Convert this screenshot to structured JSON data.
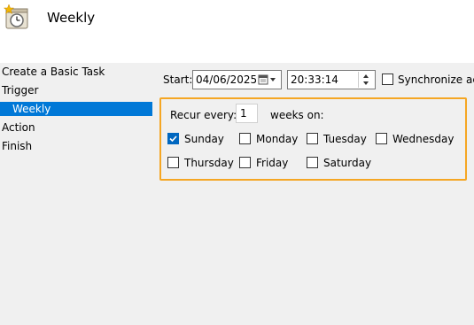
{
  "header": {
    "title": "Weekly",
    "icon": "scheduled-task-clock-icon"
  },
  "nav": {
    "items": [
      {
        "label": "Create a Basic Task"
      },
      {
        "label": "Trigger"
      },
      {
        "label": "Weekly"
      },
      {
        "label": "Action"
      },
      {
        "label": "Finish"
      }
    ],
    "selected": "Weekly"
  },
  "start": {
    "label": "Start:",
    "date": "04/06/2025",
    "time": "20:33:14",
    "sync_label": "Synchronize acro",
    "sync_checked": false
  },
  "recur": {
    "prefix": "Recur every:",
    "value": "1",
    "suffix": "weeks on:"
  },
  "days": [
    {
      "label": "Sunday",
      "checked": true
    },
    {
      "label": "Monday",
      "checked": false
    },
    {
      "label": "Tuesday",
      "checked": false
    },
    {
      "label": "Wednesday",
      "checked": false
    },
    {
      "label": "Thursday",
      "checked": false
    },
    {
      "label": "Friday",
      "checked": false
    },
    {
      "label": "Saturday",
      "checked": false
    }
  ],
  "colors": {
    "accent": "#0078d7",
    "highlight": "#f5a623",
    "check": "#0067c0"
  }
}
